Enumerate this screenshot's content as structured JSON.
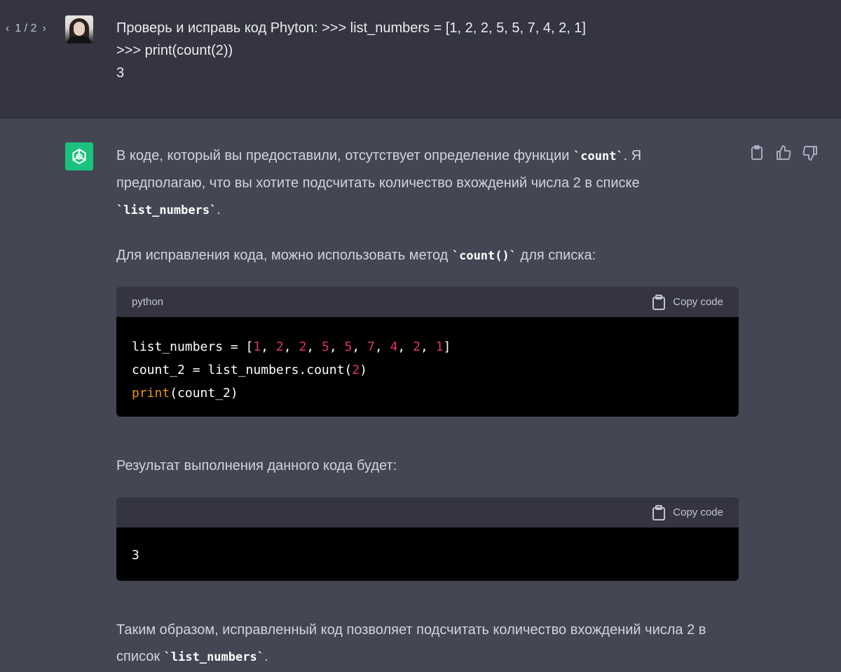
{
  "user_message": {
    "pager": {
      "prev": "‹",
      "text": "1 / 2",
      "next": "›"
    },
    "lines": [
      "Проверь и исправь код Phyton: >>> list_numbers = [1, 2, 2, 5, 5, 7, 4, 2, 1]",
      ">>> print(count(2))",
      "3"
    ]
  },
  "assistant": {
    "icons": [
      "openai-logo-icon",
      "clipboard-icon",
      "thumbs-up-icon",
      "thumbs-down-icon"
    ],
    "para1": {
      "t1": "В коде, который вы предоставили, отсутствует определение функции ",
      "c1": "`count`",
      "t2": ". Я предполагаю, что вы хотите подсчитать количество вхождений числа 2 в списке ",
      "c2": "`list_numbers`",
      "t3": "."
    },
    "para2": {
      "t1": "Для исправления кода, можно использовать метод ",
      "c1": "`count()`",
      "t2": " для списка:"
    },
    "code1": {
      "language": "python",
      "copy_label": "Copy code",
      "line1": {
        "a": "list_numbers = [",
        "n": [
          "1",
          "2",
          "2",
          "5",
          "5",
          "7",
          "4",
          "2",
          "1"
        ],
        "sep": ", ",
        "z": "]"
      },
      "line2": {
        "a": "count_2 = list_numbers.count(",
        "n": "2",
        "z": ")"
      },
      "line3": {
        "fn": "print",
        "z": "(count_2)"
      }
    },
    "para3": "Результат выполнения данного кода будет:",
    "code2": {
      "copy_label": "Copy code",
      "output": "3"
    },
    "para4": {
      "t1": "Таким образом, исправленный код позволяет подсчитать количество вхождений числа 2 в список ",
      "c1": "`list_numbers`",
      "t2": "."
    }
  },
  "colors": {
    "user_bg": "#343541",
    "assistant_bg": "#444654",
    "code_bg": "#000000",
    "number": "#df3079",
    "builtin": "#e9950c",
    "openai_green": "#19c37d"
  }
}
